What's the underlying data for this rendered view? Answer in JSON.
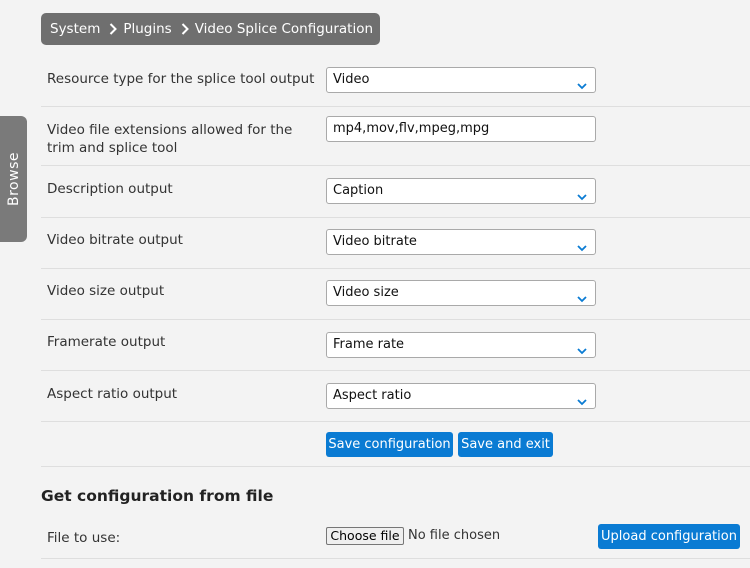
{
  "sidebar": {
    "browse_label": "Browse"
  },
  "breadcrumb": [
    "System",
    "Plugins",
    "Video Splice Configuration"
  ],
  "form": {
    "resource_type": {
      "label": "Resource type for the splice tool output",
      "value": "Video"
    },
    "extensions": {
      "label": "Video file extensions allowed for the trim and splice tool",
      "value": "mp4,mov,flv,mpeg,mpg"
    },
    "description": {
      "label": "Description output",
      "value": "Caption"
    },
    "bitrate": {
      "label": "Video bitrate output",
      "value": "Video bitrate"
    },
    "size": {
      "label": "Video size output",
      "value": "Video size"
    },
    "framerate": {
      "label": "Framerate output",
      "value": "Frame rate"
    },
    "aspect": {
      "label": "Aspect ratio output",
      "value": "Aspect ratio"
    },
    "save_label": "Save configuration",
    "save_exit_label": "Save and exit"
  },
  "file_section": {
    "title": "Get configuration from file",
    "file_label": "File to use:",
    "choose_label": "Choose file",
    "no_file": "No file chosen",
    "upload_label": "Upload configuration"
  },
  "colors": {
    "accent": "#0a7bd3",
    "breadcrumb_bg": "#6f6f6f",
    "browse_bg": "#7a7a7a"
  }
}
